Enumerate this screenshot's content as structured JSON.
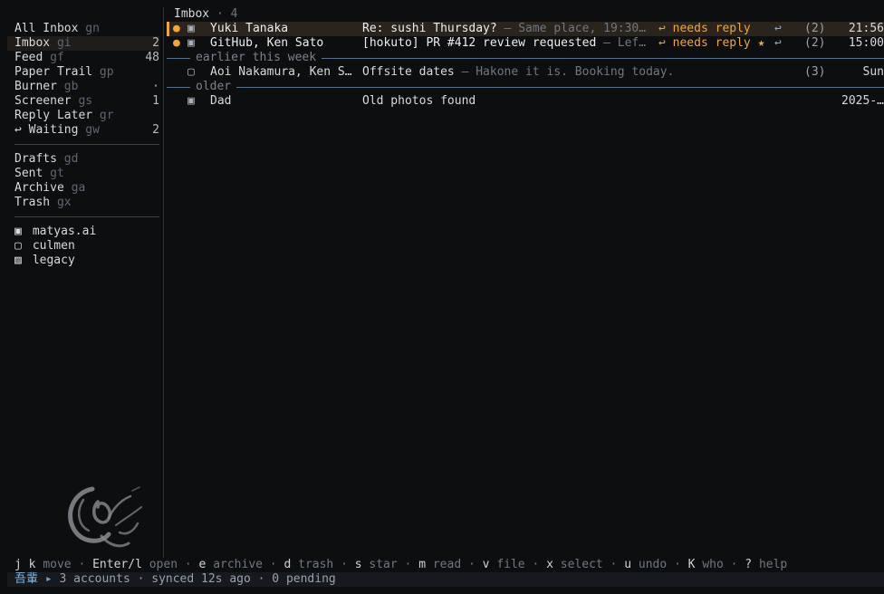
{
  "sidebar": {
    "mailboxes": [
      {
        "label": "All Inbox",
        "key": "gn",
        "count": ""
      },
      {
        "label": "Imbox",
        "key": "gi",
        "count": "2"
      },
      {
        "label": "Feed",
        "key": "gf",
        "count": "48"
      },
      {
        "label": "Paper Trail",
        "key": "gp",
        "count": ""
      },
      {
        "label": "Burner",
        "key": "gb",
        "count": "·"
      },
      {
        "label": "Screener",
        "key": "gs",
        "count": "1"
      },
      {
        "label": "Reply Later",
        "key": "gr",
        "count": ""
      },
      {
        "label": "↩ Waiting",
        "key": "gw",
        "count": "2"
      }
    ],
    "folders": [
      {
        "label": "Drafts",
        "key": "gd"
      },
      {
        "label": "Sent",
        "key": "gt"
      },
      {
        "label": "Archive",
        "key": "ga"
      },
      {
        "label": "Trash",
        "key": "gx"
      }
    ],
    "accounts": [
      {
        "icon": "▣",
        "label": "matyas.ai"
      },
      {
        "icon": "▢",
        "label": "culmen"
      },
      {
        "icon": "▨",
        "label": "legacy"
      }
    ]
  },
  "list": {
    "title": "Imbox",
    "separator": "·",
    "count": "4",
    "groups": [
      {
        "label": "",
        "messages": [
          {
            "unread": "●",
            "acct": "▣",
            "from": "Yuki Tanaka",
            "subject": "Re: sushi Thursday?",
            "snippet": " — Same place, 19:30…",
            "tag": "↩ needs reply",
            "reply": "↩",
            "count": "(2)",
            "time": "21:56"
          },
          {
            "unread": "●",
            "acct": "▣",
            "from": "GitHub, Ken Sato",
            "subject": "[hokuto] PR #412 review requested",
            "snippet": " — Lef…",
            "tag": "↩ needs reply ★",
            "reply": "↩",
            "count": "(2)",
            "time": "15:00"
          }
        ]
      },
      {
        "label": "earlier this week",
        "messages": [
          {
            "unread": "",
            "acct": "▢",
            "from": "Aoi Nakamura, Ken S…",
            "subject": "Offsite dates",
            "snippet": " — Hakone it is. Booking today.",
            "tag": "",
            "reply": "",
            "count": "(3)",
            "time": "Sun"
          }
        ]
      },
      {
        "label": "older",
        "messages": [
          {
            "unread": "",
            "acct": "▣",
            "from": "Dad",
            "subject": "Old photos found",
            "snippet": "",
            "tag": "",
            "reply": "",
            "count": "",
            "time": "2025-…"
          }
        ]
      }
    ]
  },
  "hints": [
    {
      "key": "j k",
      "label": "move"
    },
    {
      "key": "Enter/l",
      "label": "open"
    },
    {
      "key": "e",
      "label": "archive"
    },
    {
      "key": "d",
      "label": "trash"
    },
    {
      "key": "s",
      "label": "star"
    },
    {
      "key": "m",
      "label": "read"
    },
    {
      "key": "v",
      "label": "file"
    },
    {
      "key": "x",
      "label": "select"
    },
    {
      "key": "u",
      "label": "undo"
    },
    {
      "key": "K",
      "label": "who"
    },
    {
      "key": "?",
      "label": "help"
    }
  ],
  "hint_separator": " · ",
  "status": {
    "app": "吾輩",
    "arrow": "▸",
    "text": "3 accounts · synced 12s ago · 0 pending"
  },
  "colors": {
    "accent": "#e8a64a",
    "background": "#0d0e10",
    "link": "#7fb0d8"
  }
}
